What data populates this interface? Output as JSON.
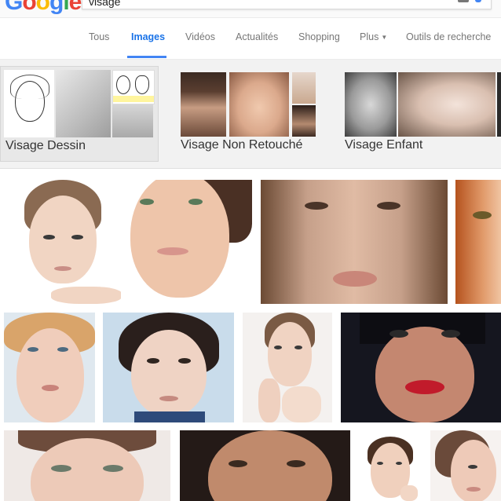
{
  "header": {
    "logo_text": "Google",
    "logo_colors": [
      "#4285f4",
      "#ea4335",
      "#fbbc05",
      "#4285f4",
      "#34a853",
      "#ea4335"
    ],
    "search_value": "visage"
  },
  "tabs": [
    {
      "label": "Tous"
    },
    {
      "label": "Images",
      "active": true
    },
    {
      "label": "Vidéos"
    },
    {
      "label": "Actualités"
    },
    {
      "label": "Shopping"
    },
    {
      "label": "Plus"
    },
    {
      "label": "Outils de recherche"
    }
  ],
  "suggestions": [
    {
      "label": "Visage Dessin"
    },
    {
      "label": "Visage Non Retouché"
    },
    {
      "label": "Visage Enfant"
    }
  ],
  "colors": {
    "accent": "#4285f4",
    "tab_text": "#777777",
    "tab_active": "#1a73e8"
  }
}
